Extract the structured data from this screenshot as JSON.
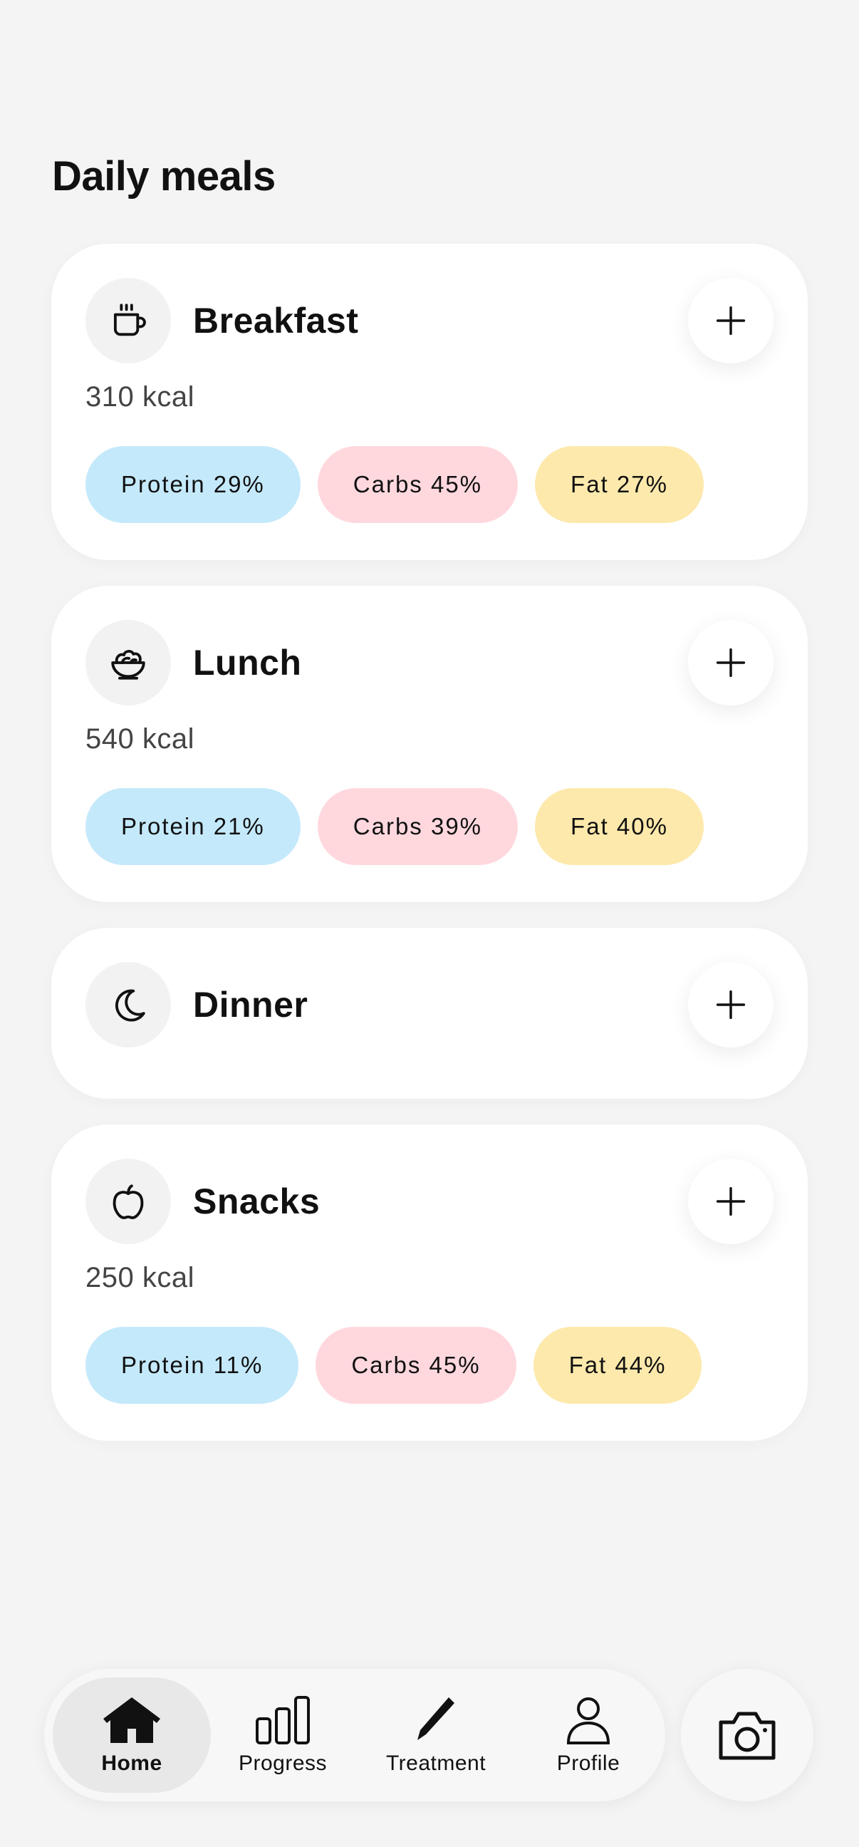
{
  "page": {
    "title": "Daily meals"
  },
  "meals": [
    {
      "name": "Breakfast",
      "icon": "coffee-cup-icon",
      "kcal": "310 kcal",
      "protein": "Protein 29%",
      "carbs": "Carbs 45%",
      "fat": "Fat 27%"
    },
    {
      "name": "Lunch",
      "icon": "salad-bowl-icon",
      "kcal": "540 kcal",
      "protein": "Protein 21%",
      "carbs": "Carbs 39%",
      "fat": "Fat 40%"
    },
    {
      "name": "Dinner",
      "icon": "moon-icon"
    },
    {
      "name": "Snacks",
      "icon": "apple-icon",
      "kcal": "250 kcal",
      "protein": "Protein 11%",
      "carbs": "Carbs 45%",
      "fat": "Fat 44%"
    }
  ],
  "nav": {
    "items": [
      {
        "label": "Home",
        "icon": "home-icon",
        "active": true
      },
      {
        "label": "Progress",
        "icon": "bar-chart-icon"
      },
      {
        "label": "Treatment",
        "icon": "pencil-icon"
      },
      {
        "label": "Profile",
        "icon": "person-icon"
      }
    ],
    "camera_icon": "camera-icon"
  },
  "colors": {
    "background": "#f4f4f4",
    "protein": "#c4e9fb",
    "carbs": "#ffd8de",
    "fat": "#fde9ac"
  }
}
